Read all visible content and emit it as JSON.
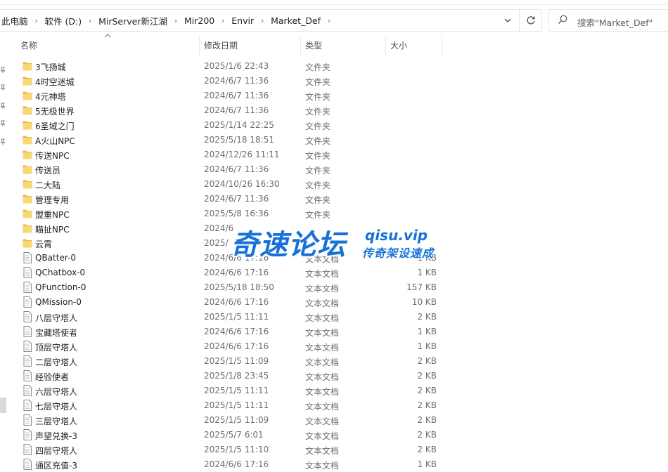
{
  "breadcrumb": [
    "此电脑",
    "软件 (D:)",
    "MirServer新江湖",
    "Mir200",
    "Envir",
    "Market_Def"
  ],
  "search": {
    "placeholder": "搜索\"Market_Def\""
  },
  "columns": {
    "name": "名称",
    "date": "修改日期",
    "type": "类型",
    "size": "大小"
  },
  "files": [
    {
      "name": "3飞扬城",
      "date": "2025/1/6 22:43",
      "type": "文件夹",
      "size": "",
      "kind": "folder"
    },
    {
      "name": "4时空迷城",
      "date": "2024/6/7 11:36",
      "type": "文件夹",
      "size": "",
      "kind": "folder"
    },
    {
      "name": "4元神塔",
      "date": "2024/6/7 11:36",
      "type": "文件夹",
      "size": "",
      "kind": "folder"
    },
    {
      "name": "5无极世界",
      "date": "2024/6/7 11:36",
      "type": "文件夹",
      "size": "",
      "kind": "folder"
    },
    {
      "name": "6圣域之门",
      "date": "2025/1/14 22:25",
      "type": "文件夹",
      "size": "",
      "kind": "folder"
    },
    {
      "name": "A火山NPC",
      "date": "2025/5/18 18:51",
      "type": "文件夹",
      "size": "",
      "kind": "folder"
    },
    {
      "name": "传送NPC",
      "date": "2024/12/26 11:11",
      "type": "文件夹",
      "size": "",
      "kind": "folder"
    },
    {
      "name": "传送员",
      "date": "2024/6/7 11:36",
      "type": "文件夹",
      "size": "",
      "kind": "folder"
    },
    {
      "name": "二大陆",
      "date": "2024/10/26 16:30",
      "type": "文件夹",
      "size": "",
      "kind": "folder"
    },
    {
      "name": "管理专用",
      "date": "2024/6/7 11:36",
      "type": "文件夹",
      "size": "",
      "kind": "folder"
    },
    {
      "name": "盟重NPC",
      "date": "2025/5/8 16:36",
      "type": "文件夹",
      "size": "",
      "kind": "folder"
    },
    {
      "name": "瞄扯NPC",
      "date": "2024/6",
      "type": "",
      "size": "",
      "kind": "folder"
    },
    {
      "name": "云霄",
      "date": "2025/",
      "type": "",
      "size": "",
      "kind": "folder"
    },
    {
      "name": "QBatter-0",
      "date": "2024/6/6 17:16",
      "type": "文本文档",
      "size": "1 KB",
      "kind": "file"
    },
    {
      "name": "QChatbox-0",
      "date": "2024/6/6 17:16",
      "type": "文本文档",
      "size": "1 KB",
      "kind": "file"
    },
    {
      "name": "QFunction-0",
      "date": "2025/5/18 18:50",
      "type": "文本文档",
      "size": "157 KB",
      "kind": "file"
    },
    {
      "name": "QMission-0",
      "date": "2024/6/6 17:16",
      "type": "文本文档",
      "size": "10 KB",
      "kind": "file"
    },
    {
      "name": "八层守塔人",
      "date": "2025/1/5 11:11",
      "type": "文本文档",
      "size": "2 KB",
      "kind": "file"
    },
    {
      "name": "宝藏塔使者",
      "date": "2024/6/6 17:16",
      "type": "文本文档",
      "size": "1 KB",
      "kind": "file"
    },
    {
      "name": "顶层守塔人",
      "date": "2024/6/6 17:16",
      "type": "文本文档",
      "size": "1 KB",
      "kind": "file"
    },
    {
      "name": "二层守塔人",
      "date": "2025/1/5 11:09",
      "type": "文本文档",
      "size": "2 KB",
      "kind": "file"
    },
    {
      "name": "经验使者",
      "date": "2025/1/8 23:45",
      "type": "文本文档",
      "size": "2 KB",
      "kind": "file"
    },
    {
      "name": "六层守塔人",
      "date": "2025/1/5 11:11",
      "type": "文本文档",
      "size": "2 KB",
      "kind": "file"
    },
    {
      "name": "七层守塔人",
      "date": "2025/1/5 11:11",
      "type": "文本文档",
      "size": "2 KB",
      "kind": "file"
    },
    {
      "name": "三层守塔人",
      "date": "2025/1/5 11:09",
      "type": "文本文档",
      "size": "2 KB",
      "kind": "file"
    },
    {
      "name": "声望兑换-3",
      "date": "2025/5/7 6:01",
      "type": "文本文档",
      "size": "2 KB",
      "kind": "file"
    },
    {
      "name": "四层守塔人",
      "date": "2025/1/5 11:10",
      "type": "文本文档",
      "size": "2 KB",
      "kind": "file"
    },
    {
      "name": "通区充值-3",
      "date": "2024/6/6 17:16",
      "type": "文本文档",
      "size": "1 KB",
      "kind": "file"
    }
  ],
  "watermark": {
    "title": "奇速论坛",
    "url": "qisu.vip",
    "subtitle": "传奇架设速成"
  },
  "colors": {
    "folder": "#f8d775",
    "folder_dark": "#e8b84a",
    "watermark": "#1672d8"
  }
}
